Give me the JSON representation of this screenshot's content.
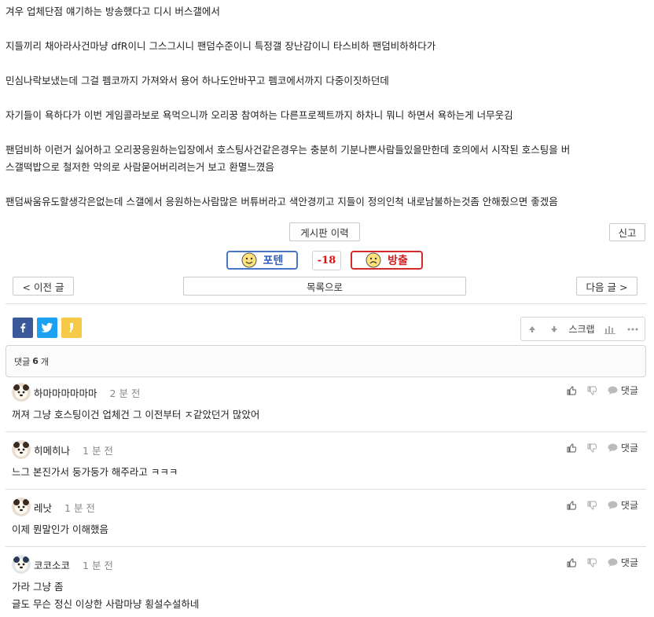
{
  "article": {
    "paragraphs": [
      "겨우 업체단점 얘기하는 방송했다고 디시 버스갤에서",
      "지들끼리 채아라사건마냥 dfR이니 그스그시니 팬덤수준이니 특정갤 장난감이니 타스비하 팬덤비하하다가",
      "민심나락보냈는데 그걸 펨코까지 가져와서 용어 하나도안바꾸고 펨코에서까지 다중이짓하던데",
      "자기들이 욕하다가 이번 게임콜라보로 욕먹으니까 오리꿍 참여하는 다른프로젝트까지 하차니 뭐니 하면서 욕하는게 너무웃김",
      "팬덤비하 이런거 싫어하고 오리꿍응원하는입장에서 호스팅사건같은경우는 충분히 기분나쁜사람들있을만한데 호의에서 시작된 호스팅을 버",
      "스갤떡밥으로 철저한 악의로 사람묻어버리려는거 보고 환멸느꼈음",
      "팬덤싸움유도할생각은없는데 스갤에서 응원하는사람많은 버튜버라고 색안경끼고 지들이 정의인척 내로남불하는것좀 안해줬으면 좋겠음"
    ]
  },
  "buttons": {
    "board_history": "게시판 이력",
    "report": "신고",
    "prev": "< 이전 글",
    "list": "목록으로",
    "next": "다음 글 >"
  },
  "vote": {
    "up_label": "포텐",
    "down_label": "방출",
    "score": "-18"
  },
  "toolbar": {
    "scrap_label": "스크랩"
  },
  "comments_header": {
    "prefix": "댓글",
    "count": "6",
    "suffix": "개"
  },
  "comment_reply_label": "댓글",
  "comments": [
    {
      "author": "하마마마마마마",
      "time": "2 분 전",
      "lines": [
        "꺼져 그냥 호스팅이건 업체건 그 이전부터 ㅈ같았던거 많았어"
      ]
    },
    {
      "author": "히메히나",
      "time": "1 분 전",
      "lines": [
        "느그 본진가서 둥가둥가 해주라고 ㅋㅋㅋ"
      ]
    },
    {
      "author": "레낫",
      "time": "1 분 전",
      "lines": [
        "이제 뭔말인가 이해했음"
      ]
    },
    {
      "author": "코코소코",
      "time": "1 분 전",
      "lines": [
        "가라 그냥 좀",
        "글도 무슨 정신 이상한 사람마냥 횡설수설하네"
      ]
    }
  ],
  "colors": {
    "potent_blue": "#4a76c7",
    "release_red": "#d22b2b",
    "facebook": "#3b5998",
    "twitter": "#1da1f2",
    "kakao": "#f7c948"
  }
}
